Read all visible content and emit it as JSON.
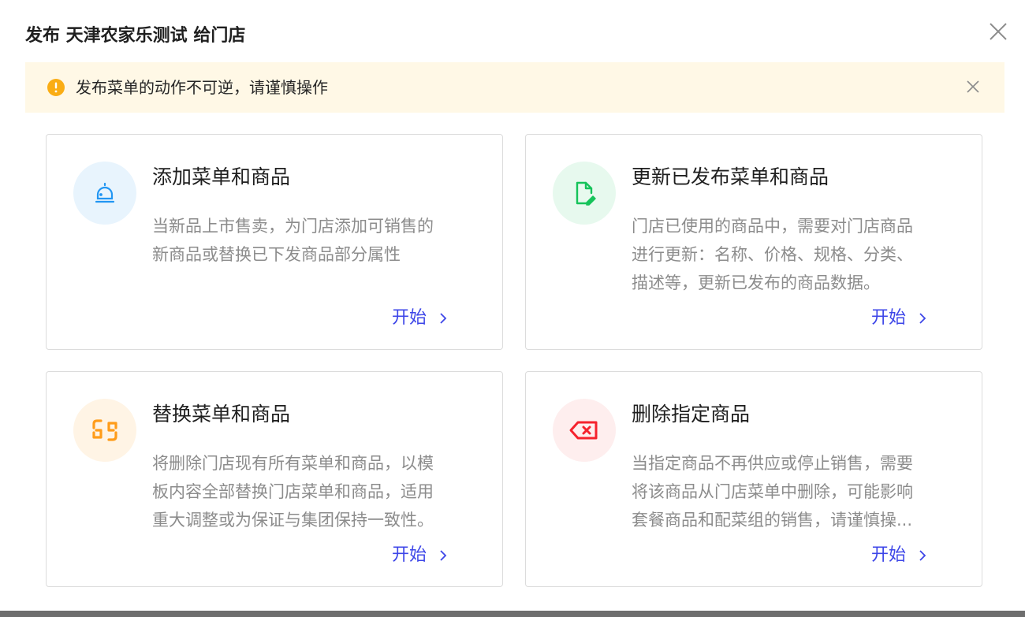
{
  "dialog": {
    "title": "发布 天津农家乐测试 给门店",
    "close_icon": "close-icon"
  },
  "alert": {
    "text": "发布菜单的动作不可逆，请谨慎操作",
    "icon": "warning-icon",
    "color": "#faad14",
    "background": "#fff8e6"
  },
  "cards": [
    {
      "title": "添加菜单和商品",
      "description": "当新品上市售卖，为门店添加可销售的\n新商品或替换已下发商品部分属性",
      "action": "开始",
      "icon": "bell-icon",
      "icon_color": "#2196f3",
      "icon_bg": "#e8f4fd"
    },
    {
      "title": "更新已发布菜单和商品",
      "description": "门店已使用的商品中，需要对门店商品\n进行更新：名称、价格、规格、分类、\n描述等，更新已发布的商品数据。",
      "action": "开始",
      "icon": "file-edit-icon",
      "icon_color": "#16c35a",
      "icon_bg": "#e7f9ee"
    },
    {
      "title": "替换菜单和商品",
      "description": "将删除门店现有所有菜单和商品，以模\n板内容全部替换门店菜单和商品，适用\n重大调整或为保证与集团保持一致性。",
      "action": "开始",
      "icon": "swap-icon",
      "icon_color": "#ff9c1a",
      "icon_bg": "#fff4e5"
    },
    {
      "title": "删除指定商品",
      "description": "当指定商品不再供应或停止销售，需要\n将该商品从门店菜单中删除，可能影响\n套餐商品和配菜组的销售，请谨慎操...",
      "action": "开始",
      "icon": "delete-tag-icon",
      "icon_color": "#f5222d",
      "icon_bg": "#feeeee"
    }
  ],
  "link_color": "#3d46e8"
}
